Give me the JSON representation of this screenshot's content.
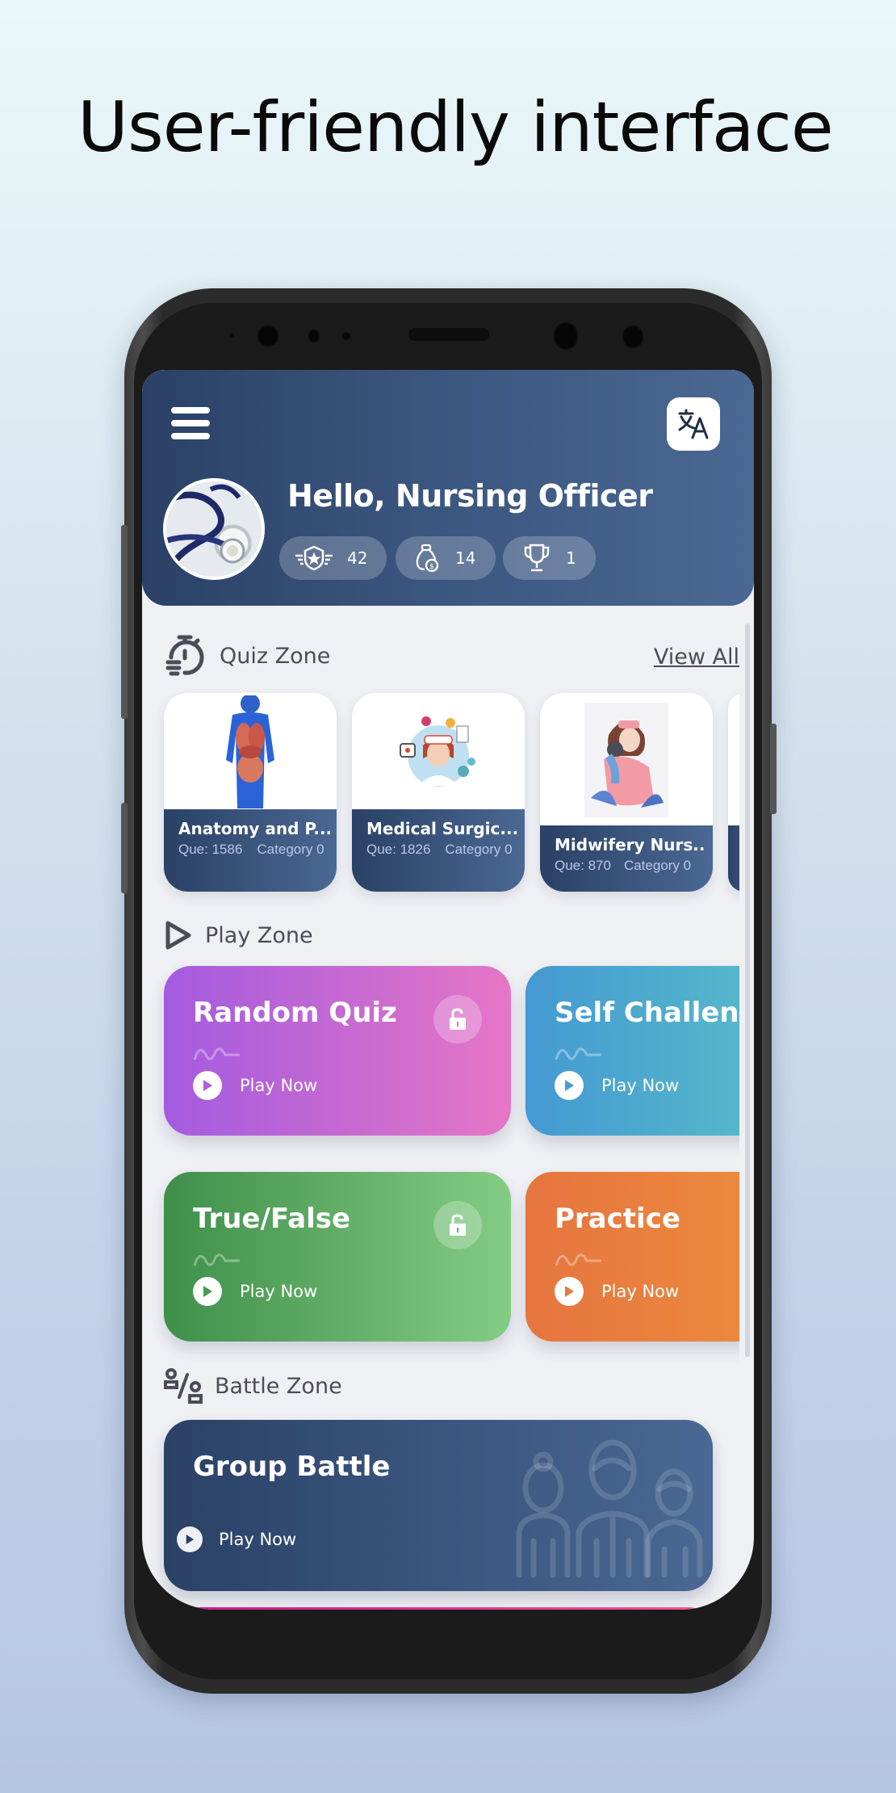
{
  "headline": "User-friendly interface",
  "header": {
    "menu_icon": "hamburger-menu-icon",
    "translate_icon": "translate-icon",
    "greeting": "Hello, Nursing Officer",
    "avatar": "stethoscope-avatar",
    "stats": [
      {
        "icon": "rank-badge-icon",
        "value": "42"
      },
      {
        "icon": "coin-bag-icon",
        "value": "14"
      },
      {
        "icon": "trophy-icon",
        "value": "1"
      }
    ]
  },
  "quiz_zone": {
    "title": "Quiz Zone",
    "icon": "stopwatch-icon",
    "view_all": "View All",
    "cards": [
      {
        "name": "Anatomy and P...",
        "questions": "Que: 1586",
        "category": "Category 0",
        "image": "anatomy-body-image"
      },
      {
        "name": "Medical Surgic...",
        "questions": "Que: 1826",
        "category": "Category 0",
        "image": "nurse-medical-image"
      },
      {
        "name": "Midwifery Nurs...",
        "questions": "Que: 870",
        "category": "Category 0",
        "image": "midwife-baby-image"
      }
    ]
  },
  "play_zone": {
    "title": "Play Zone",
    "icon": "play-outline-icon",
    "cards": [
      {
        "title": "Random Quiz",
        "action": "Play Now",
        "locked_icon": "unlock-icon",
        "color_start": "#a35be0",
        "color_end": "#e676c6"
      },
      {
        "title": "Self Challenge",
        "action": "Play Now",
        "color_start": "#4499d2",
        "color_end": "#5fc9c6"
      },
      {
        "title": "True/False",
        "action": "Play Now",
        "locked_icon": "unlock-icon",
        "color_start": "#3f8f4a",
        "color_end": "#84cc84"
      },
      {
        "title": "Practice",
        "action": "Play Now",
        "color_start": "#e6753f",
        "color_end": "#ef943d"
      }
    ]
  },
  "battle_zone": {
    "title": "Battle Zone",
    "icon": "battle-versus-icon",
    "cards": [
      {
        "title": "Group Battle",
        "action": "Play Now"
      }
    ]
  }
}
